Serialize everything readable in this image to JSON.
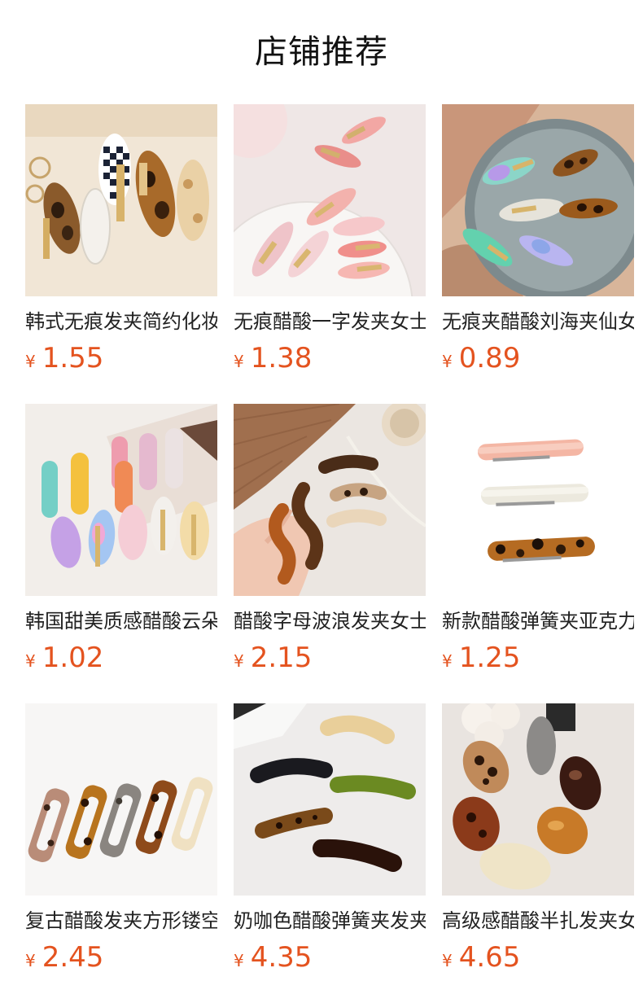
{
  "page": {
    "title": "店铺推荐"
  },
  "currency_symbol": "¥",
  "colors": {
    "price": "#e4531f",
    "title": "#111111",
    "name": "#222222"
  },
  "products": [
    {
      "name": "韩式无痕发夹简约化妆",
      "price": "1.55",
      "image": "tortoiseshell-snap-clips-photo"
    },
    {
      "name": "无痕醋酸一字发夹女士",
      "price": "1.38",
      "image": "pink-acetate-clips-photo"
    },
    {
      "name": "无痕夹醋酸刘海夹仙女",
      "price": "0.89",
      "image": "colorful-clips-on-mirror-photo"
    },
    {
      "name": "韩国甜美质感醋酸云朵",
      "price": "1.02",
      "image": "wavy-cloud-clips-photo"
    },
    {
      "name": "醋酸字母波浪发夹女士",
      "price": "2.15",
      "image": "wavy-bar-clips-in-hand-photo"
    },
    {
      "name": "新款醋酸弹簧夹亚克力",
      "price": "1.25",
      "image": "spring-barrettes-photo"
    },
    {
      "name": "复古醋酸发夹方形镂空",
      "price": "2.45",
      "image": "rectangle-hollow-clips-photo"
    },
    {
      "name": "奶咖色醋酸弹簧夹发夹",
      "price": "4.35",
      "image": "curved-spring-clips-photo"
    },
    {
      "name": "高级感醋酸半扎发夹女",
      "price": "4.65",
      "image": "oval-half-up-clips-photo"
    }
  ]
}
